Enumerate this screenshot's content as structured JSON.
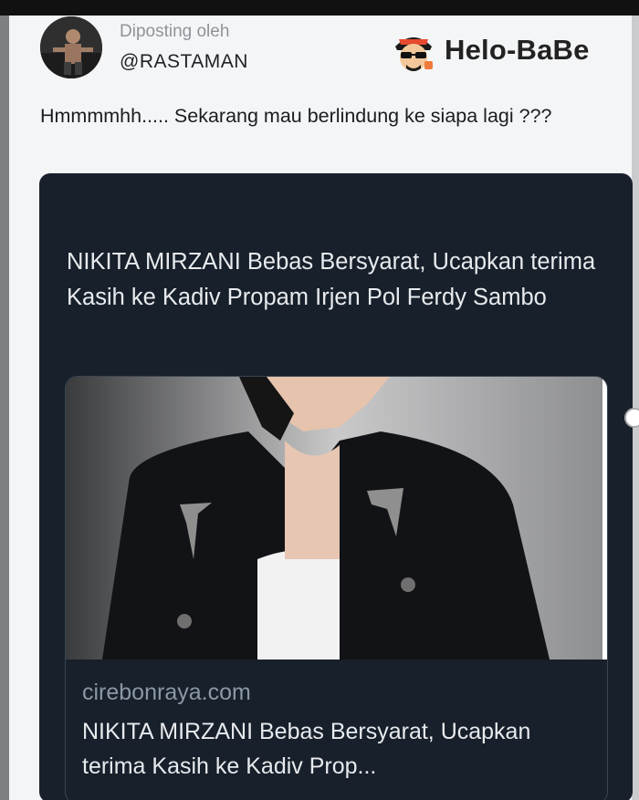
{
  "post": {
    "posted_by_label": "Diposting oleh",
    "username": "@RASTAMAN",
    "brand_name": "Helo-BaBe",
    "brand_icon": "mascot-icon",
    "text": "Hmmmmhh..... Sekarang mau berlindung ke siapa lagi ???"
  },
  "card": {
    "headline": "NIKITA MIRZANI Bebas Bersyarat, Ucapkan terima Kasih ke Kadiv Propam Irjen Pol Ferdy Sambo",
    "preview": {
      "domain": "cirebonraya.com",
      "title": "NIKITA MIRZANI Bebas Bersyarat, Ucapkan terima Kasih ke Kadiv Prop..."
    }
  },
  "colors": {
    "card_background": "#17202b",
    "page_background": "#f4f5f6",
    "muted_text": "#8b98a5"
  }
}
